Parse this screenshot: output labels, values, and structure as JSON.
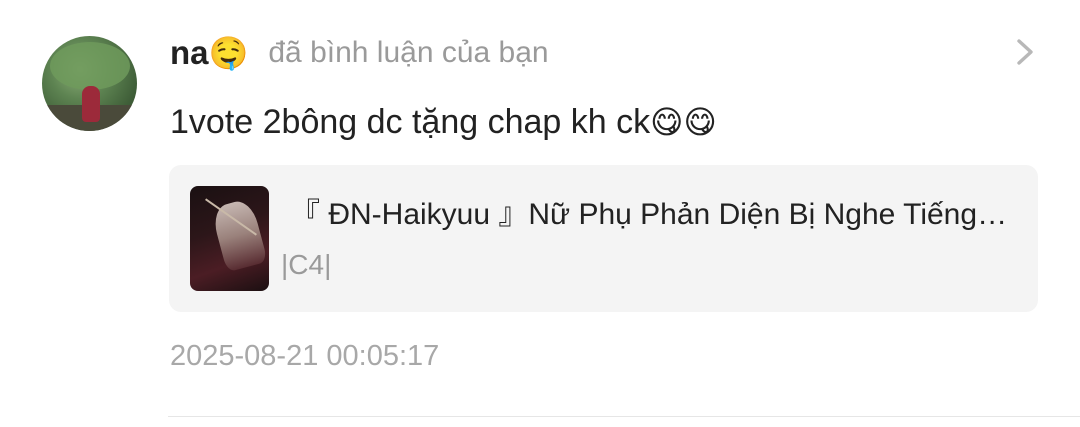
{
  "notification": {
    "user": {
      "name": "na",
      "name_emoji": "🤤",
      "avatar_icon": "user-avatar-photo"
    },
    "action_text": "đã bình luận của bạn",
    "comment_text": "1vote 2bông dc tặng chap kh ck",
    "comment_emojis": "😋😋",
    "story": {
      "title": "『 ĐN-Haikyuu 』Nữ Phụ Phản Diện Bị Nghe Tiếng Lòng",
      "chapter": "|C4|",
      "cover_icon": "story-cover-image"
    },
    "timestamp": "2025-08-21 00:05:17",
    "chevron_icon": "chevron-right-icon"
  }
}
